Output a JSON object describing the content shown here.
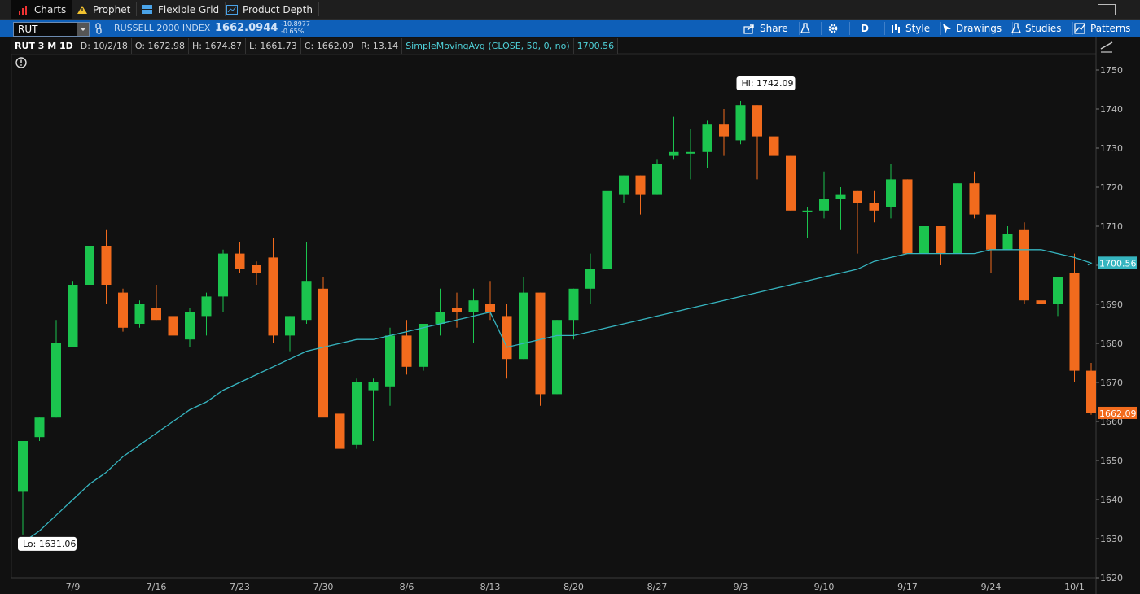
{
  "tabs": [
    {
      "label": "Charts",
      "icon": "bar-chart-icon",
      "active": true
    },
    {
      "label": "Prophet",
      "icon": "warning-triangle-icon",
      "active": false
    },
    {
      "label": "Flexible Grid",
      "icon": "grid-icon",
      "active": false
    },
    {
      "label": "Product Depth",
      "icon": "depth-chart-icon",
      "active": false
    }
  ],
  "toolbar": {
    "symbol": "RUT",
    "index_name": "RUSSELL 2000 INDEX",
    "last_price": "1662.0944",
    "change": "-10.8977",
    "change_pct": "-0.65%",
    "share": "Share",
    "period": "D",
    "style": "Style",
    "drawings": "Drawings",
    "studies": "Studies",
    "patterns": "Patterns"
  },
  "infobar": {
    "title": "RUT 3 M 1D",
    "date": "D: 10/2/18",
    "open": "O: 1672.98",
    "high": "H: 1674.87",
    "low": "L: 1661.73",
    "close": "C: 1662.09",
    "range": "R: 13.14",
    "study": "SimpleMovingAvg (CLOSE, 50, 0, no)",
    "study_value": "1700.56"
  },
  "colors": {
    "up": "#1bc44e",
    "down": "#f26b1d",
    "sma": "#36b5c0",
    "background": "#111111",
    "grid": "#1b1b1b"
  },
  "chart_data": {
    "type": "candlestick",
    "hi_label": "Hi: 1742.09",
    "lo_label": "Lo: 1631.06",
    "last_price_label": "1662.09",
    "sma_label": "1700.56",
    "x_ticks": [
      "7/9",
      "7/16",
      "7/23",
      "7/30",
      "8/6",
      "8/13",
      "8/20",
      "8/27",
      "9/3",
      "9/10",
      "9/17",
      "9/24",
      "10/1"
    ],
    "y_ticks": [
      1620,
      1630,
      1640,
      1650,
      1660,
      1670,
      1680,
      1690,
      1700,
      1710,
      1720,
      1730,
      1740,
      1750
    ],
    "ylim": [
      1619.5,
      1752.8
    ],
    "ohlc": [
      [
        1642,
        1655,
        1631.06,
        1655
      ],
      [
        1656,
        1661,
        1655,
        1661
      ],
      [
        1661,
        1686,
        1661,
        1680
      ],
      [
        1679,
        1696,
        1679,
        1695
      ],
      [
        1695,
        1705,
        1695,
        1705
      ],
      [
        1705,
        1709,
        1690,
        1695
      ],
      [
        1693,
        1694,
        1683,
        1684
      ],
      [
        1685,
        1691,
        1684,
        1690
      ],
      [
        1689,
        1695,
        1686,
        1686
      ],
      [
        1687,
        1688,
        1673,
        1682
      ],
      [
        1681,
        1689,
        1679,
        1688
      ],
      [
        1687,
        1693,
        1682,
        1692
      ],
      [
        1692,
        1704,
        1688,
        1703
      ],
      [
        1703,
        1706,
        1698,
        1699
      ],
      [
        1700,
        1701,
        1695,
        1698
      ],
      [
        1702,
        1707,
        1680,
        1682
      ],
      [
        1682,
        1687,
        1678,
        1687
      ],
      [
        1686,
        1706,
        1685,
        1696
      ],
      [
        1694,
        1697,
        1662,
        1661
      ],
      [
        1662,
        1663,
        1653,
        1653
      ],
      [
        1654,
        1671,
        1653,
        1670
      ],
      [
        1668,
        1671,
        1655,
        1670
      ],
      [
        1669,
        1684,
        1664,
        1682
      ],
      [
        1682,
        1686,
        1672,
        1674
      ],
      [
        1674,
        1685,
        1673,
        1685
      ],
      [
        1685,
        1694,
        1682,
        1688
      ],
      [
        1689,
        1693,
        1684,
        1688
      ],
      [
        1688,
        1694,
        1680,
        1691
      ],
      [
        1690,
        1696,
        1686,
        1688
      ],
      [
        1687,
        1690,
        1671,
        1676
      ],
      [
        1676,
        1697,
        1676,
        1693
      ],
      [
        1693,
        1693,
        1664,
        1667
      ],
      [
        1667,
        1686,
        1667,
        1686
      ],
      [
        1686,
        1694,
        1681,
        1694
      ],
      [
        1694,
        1703,
        1690,
        1699
      ],
      [
        1699,
        1719,
        1699,
        1719
      ],
      [
        1718,
        1723,
        1716,
        1723
      ],
      [
        1723,
        1723,
        1713,
        1718
      ],
      [
        1718,
        1727,
        1718,
        1726
      ],
      [
        1728,
        1738,
        1727,
        1729
      ],
      [
        1729,
        1735,
        1722,
        1729
      ],
      [
        1729,
        1737,
        1725,
        1736
      ],
      [
        1736,
        1740,
        1728,
        1733
      ],
      [
        1732,
        1742.09,
        1731,
        1741
      ],
      [
        1741,
        1741,
        1722,
        1733
      ],
      [
        1733,
        1729,
        1714,
        1728
      ],
      [
        1728,
        1728,
        1714,
        1714
      ],
      [
        1714,
        1715,
        1707,
        1714
      ],
      [
        1714,
        1724,
        1712,
        1717
      ],
      [
        1717,
        1720,
        1709,
        1718
      ],
      [
        1719,
        1719,
        1703,
        1716
      ],
      [
        1716,
        1719,
        1711,
        1714
      ],
      [
        1715,
        1726,
        1712,
        1722
      ],
      [
        1722,
        1722,
        1703,
        1703
      ],
      [
        1703,
        1710,
        1703,
        1710
      ],
      [
        1710,
        1710,
        1700,
        1703
      ],
      [
        1703,
        1721,
        1703,
        1721
      ],
      [
        1721,
        1724,
        1712,
        1713
      ],
      [
        1713,
        1713,
        1698,
        1704
      ],
      [
        1704,
        1710,
        1704,
        1708
      ],
      [
        1709,
        1711,
        1690,
        1691
      ],
      [
        1691,
        1693,
        1689,
        1690
      ],
      [
        1690,
        1697,
        1687,
        1697
      ],
      [
        1698,
        1703,
        1670,
        1673
      ],
      [
        1673,
        1675,
        1661.73,
        1662.09
      ]
    ],
    "sma": [
      1629,
      1632,
      1636,
      1640,
      1644,
      1647,
      1651,
      1654,
      1657,
      1660,
      1663,
      1665,
      1668,
      1670,
      1672,
      1674,
      1676,
      1678,
      1679,
      1680,
      1681,
      1681,
      1682,
      1683,
      1684,
      1685,
      1686,
      1687,
      1688,
      1679,
      1680,
      1681,
      1682,
      1682,
      1683,
      1684,
      1685,
      1686,
      1687,
      1688,
      1689,
      1690,
      1691,
      1692,
      1693,
      1694,
      1695,
      1696,
      1697,
      1698,
      1699,
      1701,
      1702,
      1703,
      1703,
      1703,
      1703,
      1703,
      1704,
      1704,
      1704,
      1704,
      1703,
      1702,
      1700.56
    ]
  }
}
